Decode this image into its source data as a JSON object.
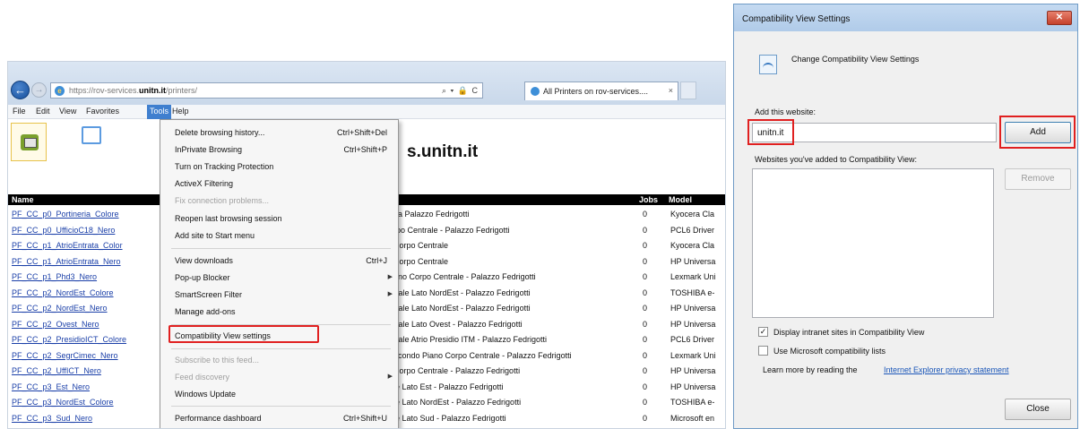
{
  "browser": {
    "url_prefix": "https://rov-services.",
    "url_domain": "unitn.it",
    "url_path": "/printers/",
    "url_icons": "⌕ ▾ 🔒 C",
    "tab_label": "All Printers on rov-services....",
    "tab_close": "×"
  },
  "menubar": {
    "items": [
      "File",
      "Edit",
      "View",
      "Favorites",
      "Tools",
      "Help"
    ]
  },
  "page": {
    "title": "s.unitn.it",
    "columns": {
      "name": "Name",
      "jobs": "Jobs",
      "model": "Model"
    },
    "rows": [
      {
        "name": "PF_CC_p0_Portineria_Colore",
        "location": "ria Palazzo Fedrigotti",
        "jobs": "0",
        "model": "Kyocera Cla"
      },
      {
        "name": "PF_CC_p0_UfficioC18_Nero",
        "location": "rpo Centrale - Palazzo Fedrigotti",
        "jobs": "0",
        "model": "PCL6 Driver"
      },
      {
        "name": "PF_CC_p1_AtrioEntrata_Color",
        "location": "Corpo Centrale",
        "jobs": "0",
        "model": "Kyocera Cla"
      },
      {
        "name": "PF_CC_p1_AtrioEntrata_Nero",
        "location": "Corpo Centrale",
        "jobs": "0",
        "model": "HP Universa"
      },
      {
        "name": "PF_CC_p1_Phd3_Nero",
        "location": "ano Corpo Centrale - Palazzo Fedrigotti",
        "jobs": "0",
        "model": "Lexmark Uni"
      },
      {
        "name": "PF_CC_p2_NordEst_Colore",
        "location": "trale Lato NordEst - Palazzo Fedrigotti",
        "jobs": "0",
        "model": "TOSHIBA e-"
      },
      {
        "name": "PF_CC_p2_NordEst_Nero",
        "location": "trale Lato NordEst - Palazzo Fedrigotti",
        "jobs": "0",
        "model": "HP Universa"
      },
      {
        "name": "PF_CC_p2_Ovest_Nero",
        "location": "trale Lato Ovest - Palazzo Fedrigotti",
        "jobs": "0",
        "model": "HP Universa"
      },
      {
        "name": "PF_CC_p2_PresidioICT_Colore",
        "location": "trale Atrio Presidio ITM - Palazzo Fedrigotti",
        "jobs": "0",
        "model": "PCL6 Driver"
      },
      {
        "name": "PF_CC_p2_SegrCimec_Nero",
        "location": "econdo Piano Corpo Centrale - Palazzo Fedrigotti",
        "jobs": "0",
        "model": "Lexmark Uni"
      },
      {
        "name": "PF_CC_p2_UffICT_Nero",
        "location": "Corpo Centrale - Palazzo Fedrigotti",
        "jobs": "0",
        "model": "HP Universa"
      },
      {
        "name": "PF_CC_p3_Est_Nero",
        "location": "le Lato Est - Palazzo Fedrigotti",
        "jobs": "0",
        "model": "HP Universa"
      },
      {
        "name": "PF_CC_p3_NordEst_Colore",
        "location": "le Lato NordEst - Palazzo Fedrigotti",
        "jobs": "0",
        "model": "TOSHIBA e-"
      },
      {
        "name": "PF_CC_p3_Sud_Nero",
        "location": "le Lato Sud - Palazzo Fedrigotti",
        "jobs": "0",
        "model": "Microsoft en"
      }
    ]
  },
  "tools_menu": {
    "items": [
      {
        "label": "Delete browsing history...",
        "shortcut": "Ctrl+Shift+Del"
      },
      {
        "label": "InPrivate Browsing",
        "shortcut": "Ctrl+Shift+P"
      },
      {
        "label": "Turn on Tracking Protection",
        "shortcut": ""
      },
      {
        "label": "ActiveX Filtering",
        "shortcut": ""
      },
      {
        "label": "Fix connection problems...",
        "shortcut": ""
      },
      {
        "label": "Reopen last browsing session",
        "shortcut": ""
      },
      {
        "label": "Add site to Start menu",
        "shortcut": ""
      },
      {
        "label": "View downloads",
        "shortcut": "Ctrl+J"
      },
      {
        "label": "Pop-up Blocker",
        "shortcut": ""
      },
      {
        "label": "SmartScreen Filter",
        "shortcut": ""
      },
      {
        "label": "Manage add-ons",
        "shortcut": ""
      },
      {
        "label": "Compatibility View settings",
        "shortcut": ""
      },
      {
        "label": "Subscribe to this feed...",
        "shortcut": ""
      },
      {
        "label": "Feed discovery",
        "shortcut": ""
      },
      {
        "label": "Windows Update",
        "shortcut": ""
      },
      {
        "label": "Performance dashboard",
        "shortcut": "Ctrl+Shift+U"
      }
    ]
  },
  "dialog": {
    "title": "Compatibility View Settings",
    "close_glyph": "✕",
    "heading": "Change Compatibility View Settings",
    "add_label": "Add this website:",
    "input_value": "unitn.it",
    "add_button": "Add",
    "list_label": "Websites you've added to Compatibility View:",
    "remove_button": "Remove",
    "checkbox_intranet": "Display intranet sites in Compatibility View",
    "checkbox_intranet_checked": true,
    "checkbox_mslists": "Use Microsoft compatibility lists",
    "checkbox_mslists_checked": false,
    "privacy_prefix": "Learn more by reading the",
    "privacy_link": "Internet Explorer privacy statement",
    "close_button": "Close"
  },
  "highlight_color": "#e02020"
}
